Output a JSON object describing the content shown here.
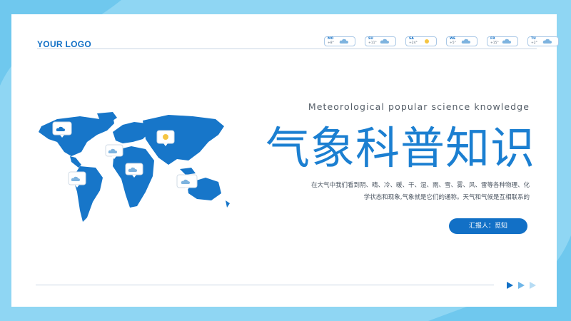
{
  "logo": "YOUR LOGO",
  "weather": [
    {
      "day": "MO",
      "temp": "+8°",
      "icon": "cloud-icon"
    },
    {
      "day": "SU",
      "temp": "+11°",
      "icon": "cloud-icon"
    },
    {
      "day": "SA",
      "temp": "+24°",
      "icon": "sun-icon"
    },
    {
      "day": "WE",
      "temp": "+5°",
      "icon": "cloud-icon"
    },
    {
      "day": "FR",
      "temp": "+15°",
      "icon": "cloud-icon"
    },
    {
      "day": "TU",
      "temp": "+2°",
      "icon": "cloud-icon"
    }
  ],
  "subtitle": "Meteorological popular science knowledge",
  "title": "气象科普知识",
  "description_lines": [
    "在大气中我们看到阴、晴、冷、暖、干、湿、雨、雪、雾、风、雷等各种物理、化",
    "学状态和现象,气象就是它们的通称。天气和气候是互相联系的"
  ],
  "reporter": "汇报人：觅知",
  "colors": {
    "accent": "#1b7fd1",
    "dark_accent": "#1270c6",
    "background": "#8fd6f3"
  },
  "map_markers": [
    "cloud-icon",
    "cloud-icon",
    "cloud-icon",
    "sun-icon",
    "cloud-icon",
    "cloud-icon"
  ]
}
